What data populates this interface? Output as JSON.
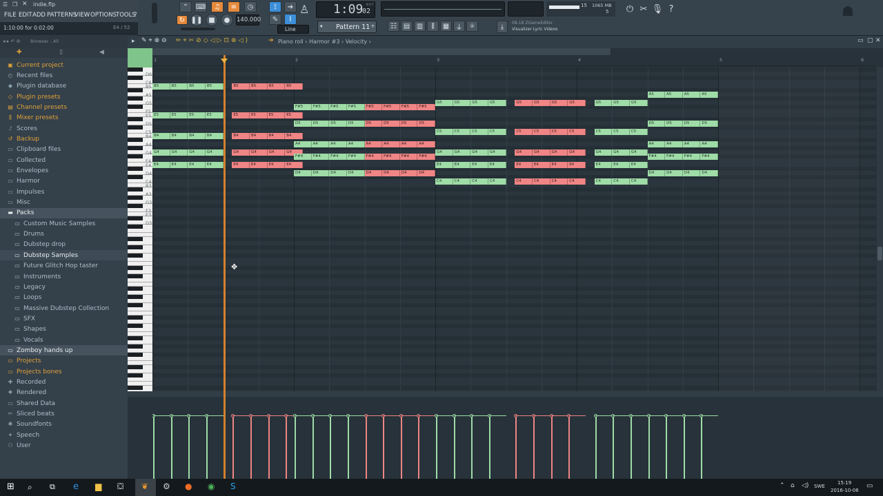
{
  "window": {
    "project_file": "indie.flp",
    "hint_text": "1:10:00 for 0:02:00",
    "hint_right": "E4 / 52"
  },
  "menu": [
    "FILE",
    "EDIT",
    "ADD",
    "PATTERNS",
    "VIEW",
    "OPTIONS",
    "TOOLS",
    "?"
  ],
  "transport": {
    "time": "1:09",
    "time_sub": "02",
    "bst_label": "B:S:T",
    "tempo": "140.000",
    "snap": "Line",
    "pattern": "Pattern 11"
  },
  "monitor": {
    "cpu": "15",
    "mem": "1065 MB",
    "poly": "5"
  },
  "news": {
    "line1": "08-18  ZGameEditor",
    "line2": "Visualizer Lyric Videos"
  },
  "browser": {
    "header": "Browser - All",
    "items": [
      {
        "label": "Current project",
        "kind": "pk",
        "icon": "project-icon"
      },
      {
        "label": "Recent files",
        "kind": "folder",
        "icon": "recent-icon"
      },
      {
        "label": "Plugin database",
        "kind": "folder",
        "icon": "plugin-icon"
      },
      {
        "label": "Plugin presets",
        "kind": "pk",
        "icon": "plugin-presets-icon"
      },
      {
        "label": "Channel presets",
        "kind": "pk",
        "icon": "channel-icon"
      },
      {
        "label": "Mixer presets",
        "kind": "pk",
        "icon": "mixer-icon"
      },
      {
        "label": "Scores",
        "kind": "folder",
        "icon": "scores-icon"
      },
      {
        "label": "Backup",
        "kind": "pk",
        "icon": "backup-icon"
      },
      {
        "label": "Clipboard files",
        "kind": "folder",
        "icon": "folder-icon"
      },
      {
        "label": "Collected",
        "kind": "folder",
        "icon": "folder-icon"
      },
      {
        "label": "Envelopes",
        "kind": "folder",
        "icon": "folder-icon"
      },
      {
        "label": "Harmor",
        "kind": "folder",
        "icon": "folder-icon"
      },
      {
        "label": "Impulses",
        "kind": "folder",
        "icon": "folder-icon"
      },
      {
        "label": "Misc",
        "kind": "folder",
        "icon": "folder-icon"
      },
      {
        "label": "Packs",
        "kind": "sel",
        "icon": "folder-open-icon"
      },
      {
        "label": "Custom Music Samples",
        "kind": "sub",
        "icon": "folder-icon"
      },
      {
        "label": "Drums",
        "kind": "sub",
        "icon": "folder-icon"
      },
      {
        "label": "Dubstep drop",
        "kind": "sub",
        "icon": "folder-icon"
      },
      {
        "label": "Dubstep Samples",
        "kind": "sub hl",
        "icon": "folder-icon"
      },
      {
        "label": "Future Glitch Hop taster",
        "kind": "sub",
        "icon": "folder-icon"
      },
      {
        "label": "Instruments",
        "kind": "sub",
        "icon": "folder-icon"
      },
      {
        "label": "Legacy",
        "kind": "sub",
        "icon": "folder-icon"
      },
      {
        "label": "Loops",
        "kind": "sub",
        "icon": "folder-icon"
      },
      {
        "label": "Massive Dubstep Collection",
        "kind": "sub",
        "icon": "folder-icon"
      },
      {
        "label": "SFX",
        "kind": "sub",
        "icon": "folder-icon"
      },
      {
        "label": "Shapes",
        "kind": "sub",
        "icon": "folder-icon"
      },
      {
        "label": "Vocals",
        "kind": "sub",
        "icon": "folder-icon"
      },
      {
        "label": "Zomboy hands up",
        "kind": "sel",
        "icon": "folder-icon"
      },
      {
        "label": "Projects",
        "kind": "pk",
        "icon": "folder-icon"
      },
      {
        "label": "Projects bones",
        "kind": "pk",
        "icon": "folder-icon"
      },
      {
        "label": "Recorded",
        "kind": "folder",
        "icon": "recorded-icon"
      },
      {
        "label": "Rendered",
        "kind": "folder",
        "icon": "rendered-icon"
      },
      {
        "label": "Shared Data",
        "kind": "folder",
        "icon": "folder-icon"
      },
      {
        "label": "Sliced beats",
        "kind": "folder",
        "icon": "sliced-icon"
      },
      {
        "label": "Soundfonts",
        "kind": "folder",
        "icon": "soundfont-icon"
      },
      {
        "label": "Speech",
        "kind": "folder",
        "icon": "speech-icon"
      },
      {
        "label": "User",
        "kind": "folder",
        "icon": "user-icon"
      }
    ]
  },
  "pianoroll": {
    "breadcrumb": [
      "Piano roll",
      "Harmor #3",
      "Velocity"
    ],
    "bars": [
      "1",
      "2",
      "3",
      "4",
      "5",
      "6"
    ],
    "keys": [
      "D6",
      "C6",
      "B5",
      "A5",
      "G5",
      "F5",
      "E5",
      "D5",
      "C5",
      "B4",
      "A4",
      "G4",
      "F4",
      "E4",
      "D4",
      "C4",
      "B3",
      "A3",
      "G3",
      "F3",
      "E3",
      "D3"
    ],
    "notes": [
      {
        "n": "B5",
        "s": 0,
        "l": 4,
        "c": "g"
      },
      {
        "n": "B5",
        "s": 4.5,
        "l": 4,
        "c": "r"
      },
      {
        "n": "E5",
        "s": 0,
        "l": 4,
        "c": "g"
      },
      {
        "n": "E5",
        "s": 4.5,
        "l": 4,
        "c": "r"
      },
      {
        "n": "B4",
        "s": 0,
        "l": 4,
        "c": "g"
      },
      {
        "n": "B4",
        "s": 4.5,
        "l": 4,
        "c": "r"
      },
      {
        "n": "G4",
        "s": 0,
        "l": 4,
        "c": "g"
      },
      {
        "n": "G4",
        "s": 4.5,
        "l": 4,
        "c": "r"
      },
      {
        "n": "E4",
        "s": 0,
        "l": 4,
        "c": "g"
      },
      {
        "n": "E4",
        "s": 4.5,
        "l": 4,
        "c": "r"
      },
      {
        "n": "F#5",
        "s": 8,
        "l": 4,
        "c": "g"
      },
      {
        "n": "F#5",
        "s": 12,
        "l": 4,
        "c": "r"
      },
      {
        "n": "D5",
        "s": 8,
        "l": 4,
        "c": "g"
      },
      {
        "n": "D5",
        "s": 12,
        "l": 4,
        "c": "r"
      },
      {
        "n": "A4",
        "s": 8,
        "l": 4,
        "c": "g"
      },
      {
        "n": "A4",
        "s": 12,
        "l": 4,
        "c": "r"
      },
      {
        "n": "F#4",
        "s": 8,
        "l": 4,
        "c": "g"
      },
      {
        "n": "F#4",
        "s": 12,
        "l": 4,
        "c": "r"
      },
      {
        "n": "D4",
        "s": 8,
        "l": 4,
        "c": "g"
      },
      {
        "n": "D4",
        "s": 12,
        "l": 4,
        "c": "r"
      },
      {
        "n": "G5",
        "s": 16,
        "l": 4,
        "c": "g"
      },
      {
        "n": "G5",
        "s": 20.5,
        "l": 4,
        "c": "r"
      },
      {
        "n": "G5",
        "s": 25,
        "l": 3,
        "c": "g"
      },
      {
        "n": "C5",
        "s": 16,
        "l": 4,
        "c": "g"
      },
      {
        "n": "C5",
        "s": 20.5,
        "l": 4,
        "c": "r"
      },
      {
        "n": "C5",
        "s": 25,
        "l": 3,
        "c": "g"
      },
      {
        "n": "G4",
        "s": 16,
        "l": 4,
        "c": "g"
      },
      {
        "n": "G4",
        "s": 20.5,
        "l": 4,
        "c": "r"
      },
      {
        "n": "G4",
        "s": 25,
        "l": 3,
        "c": "g"
      },
      {
        "n": "E4",
        "s": 16,
        "l": 4,
        "c": "g"
      },
      {
        "n": "E4",
        "s": 20.5,
        "l": 4,
        "c": "r"
      },
      {
        "n": "E4",
        "s": 25,
        "l": 3,
        "c": "g"
      },
      {
        "n": "C4",
        "s": 16,
        "l": 4,
        "c": "g"
      },
      {
        "n": "C4",
        "s": 20.5,
        "l": 4,
        "c": "r"
      },
      {
        "n": "C4",
        "s": 25,
        "l": 3,
        "c": "g"
      },
      {
        "n": "A5",
        "s": 28,
        "l": 4,
        "c": "g"
      },
      {
        "n": "D5",
        "s": 28,
        "l": 4,
        "c": "g"
      },
      {
        "n": "A4",
        "s": 28,
        "l": 4,
        "c": "g"
      },
      {
        "n": "F#4",
        "s": 28,
        "l": 4,
        "c": "g"
      },
      {
        "n": "D4",
        "s": 28,
        "l": 4,
        "c": "g"
      }
    ]
  },
  "taskbar": {
    "lang": "SWE",
    "time": "15:19",
    "date": "2016-10-06"
  }
}
